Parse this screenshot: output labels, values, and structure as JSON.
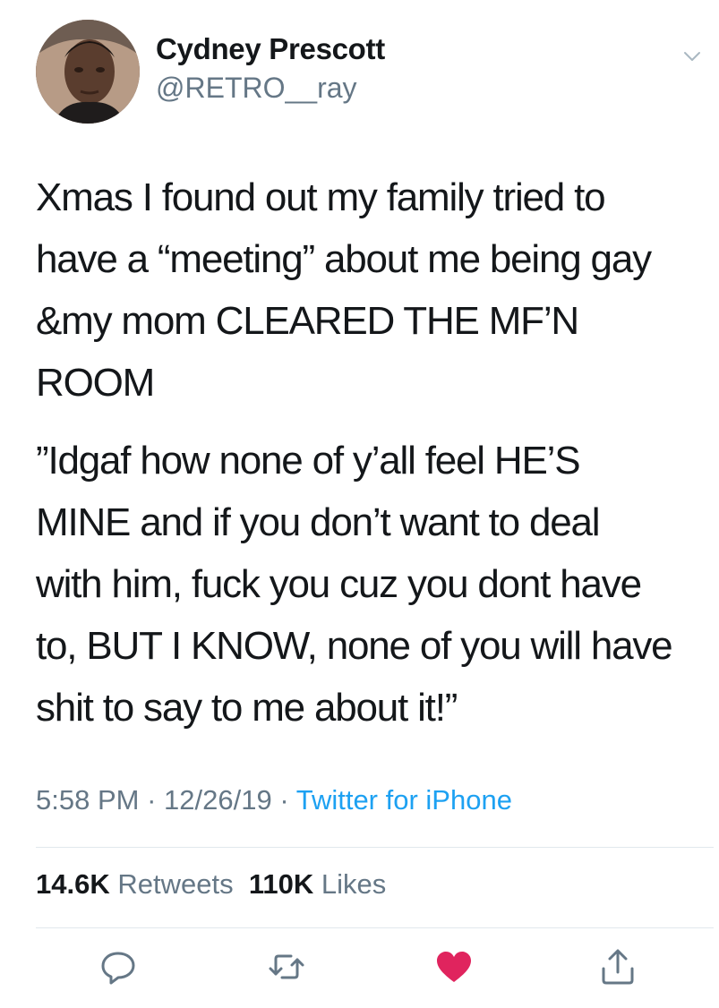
{
  "user": {
    "display_name": "Cydney Prescott",
    "handle": "@RETRO__ray"
  },
  "header": {
    "menu_icon": "chevron-down-icon"
  },
  "tweet": {
    "paragraphs": [
      [
        "Xmas I found out my family tried to",
        "have a “meeting” about me being gay",
        "&my mom CLEARED THE MF’N",
        "ROOM"
      ],
      [
        "”Idgaf how none of y’all feel HE’S",
        "MINE and if you don’t want to deal",
        "with him, fuck you cuz you dont have",
        "to, BUT I KNOW, none of you will have",
        "shit to say to me about it!”"
      ]
    ],
    "time": "5:58 PM",
    "separator": "·",
    "date": "12/26/19",
    "source": "Twitter for iPhone"
  },
  "stats": {
    "retweets_count": "14.6K",
    "retweets_label": "Retweets",
    "likes_count": "110K",
    "likes_label": "Likes"
  },
  "actions": {
    "reply_icon": "reply-icon",
    "retweet_icon": "retweet-icon",
    "like_icon": "heart-icon",
    "share_icon": "share-icon",
    "liked": true
  },
  "colors": {
    "text": "#14171a",
    "secondary": "#657786",
    "link": "#1da1f2",
    "like": "#e0245e",
    "divider": "#e1e8ed"
  }
}
